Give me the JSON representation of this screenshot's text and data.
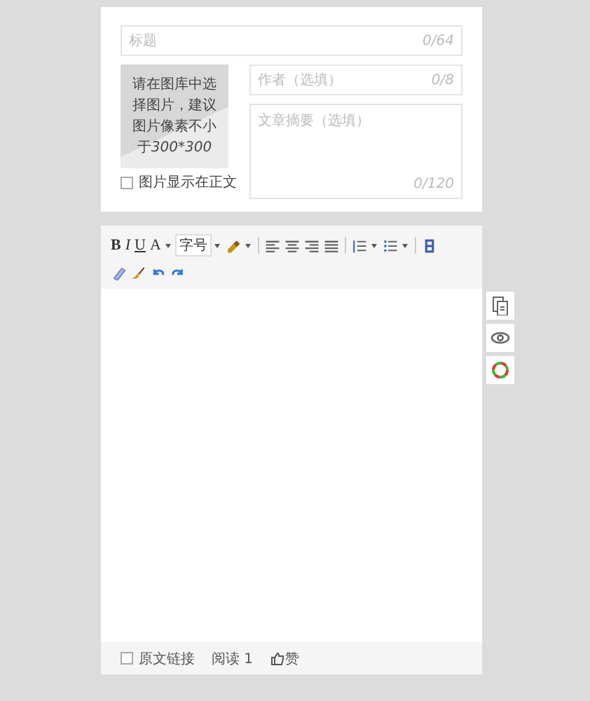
{
  "cover_card": {
    "title_field": {
      "placeholder": "标题",
      "counter": "0/64"
    },
    "cover_image": {
      "hint": "请在图库中选择图片，建议图片像素不小于",
      "size": "300*300"
    },
    "show_in_body": {
      "label": "图片显示在正文",
      "checked": false
    },
    "author_field": {
      "placeholder": "作者（选填）",
      "counter": "0/8"
    },
    "summary_field": {
      "placeholder": "文章摘要（选填）",
      "counter": "0/120"
    }
  },
  "editor": {
    "toolbar_rows": [
      [
        {
          "kind": "text",
          "label": "B"
        },
        {
          "kind": "text",
          "label": "I"
        },
        {
          "kind": "text",
          "label": "U"
        },
        {
          "kind": "text",
          "label": "A"
        },
        {
          "kind": "select",
          "label": "字号"
        },
        {
          "kind": "icon"
        },
        {
          "kind": "separator"
        },
        {
          "kind": "icon"
        },
        {
          "kind": "icon"
        },
        {
          "kind": "icon"
        },
        {
          "kind": "icon"
        },
        {
          "kind": "separator"
        },
        {
          "kind": "icon"
        },
        {
          "kind": "icon"
        },
        {
          "kind": "separator"
        },
        {
          "kind": "icon"
        }
      ],
      [
        {
          "kind": "icon"
        },
        {
          "kind": "icon"
        },
        {
          "kind": "icon"
        },
        {
          "kind": "icon"
        }
      ]
    ],
    "footer": {
      "original_link": {
        "label": "原文链接",
        "checked": false
      },
      "reads": "阅读 1",
      "like": "赞"
    }
  },
  "side_buttons": [
    {
      "kind": "icon"
    },
    {
      "kind": "icon"
    },
    {
      "kind": "icon"
    }
  ]
}
